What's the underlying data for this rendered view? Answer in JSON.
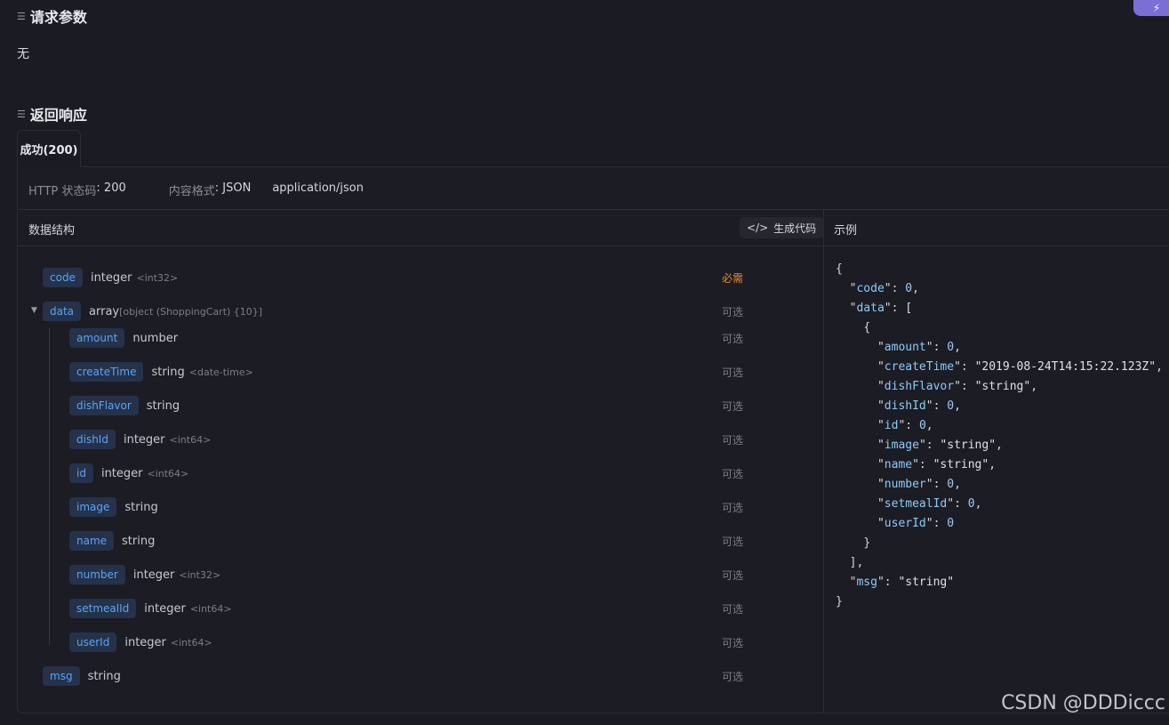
{
  "request": {
    "title": "请求参数",
    "body_text": "无"
  },
  "response": {
    "title": "返回响应",
    "tab_label": "成功(200)",
    "status_label": "HTTP 状态码",
    "status_value": ": 200",
    "format_label": "内容格式",
    "format_value": ": JSON",
    "mime": "application/json",
    "struct_header": "数据结构",
    "gen_code_label": "生成代码",
    "example_header": "示例"
  },
  "fields": [
    {
      "name": "code",
      "type": "integer",
      "format": "<int32>",
      "req": "必需"
    },
    {
      "name": "data",
      "type": "array",
      "format": "[object (ShoppingCart) {10}]",
      "req": "可选"
    },
    {
      "name": "amount",
      "type": "number",
      "format": "",
      "req": "可选"
    },
    {
      "name": "createTime",
      "type": "string",
      "format": "<date-time>",
      "req": "可选"
    },
    {
      "name": "dishFlavor",
      "type": "string",
      "format": "",
      "req": "可选"
    },
    {
      "name": "dishId",
      "type": "integer",
      "format": "<int64>",
      "req": "可选"
    },
    {
      "name": "id",
      "type": "integer",
      "format": "<int64>",
      "req": "可选"
    },
    {
      "name": "image",
      "type": "string",
      "format": "",
      "req": "可选"
    },
    {
      "name": "name",
      "type": "string",
      "format": "",
      "req": "可选"
    },
    {
      "name": "number",
      "type": "integer",
      "format": "<int32>",
      "req": "可选"
    },
    {
      "name": "setmealId",
      "type": "integer",
      "format": "<int64>",
      "req": "可选"
    },
    {
      "name": "userId",
      "type": "integer",
      "format": "<int64>",
      "req": "可选"
    },
    {
      "name": "msg",
      "type": "string",
      "format": "",
      "req": "可选"
    }
  ],
  "example_json": [
    {
      "t": "{"
    },
    {
      "k": "code",
      "v": "0",
      "n": true,
      "c": ","
    },
    {
      "k": "data",
      "v": "[",
      "c": ""
    },
    {
      "t": "{"
    },
    {
      "k": "amount",
      "v": "0",
      "n": true,
      "c": ","
    },
    {
      "k": "createTime",
      "v": "\"2019-08-24T14:15:22.123Z\"",
      "c": ","
    },
    {
      "k": "dishFlavor",
      "v": "\"string\"",
      "c": ","
    },
    {
      "k": "dishId",
      "v": "0",
      "n": true,
      "c": ","
    },
    {
      "k": "id",
      "v": "0",
      "n": true,
      "c": ","
    },
    {
      "k": "image",
      "v": "\"string\"",
      "c": ","
    },
    {
      "k": "name",
      "v": "\"string\"",
      "c": ","
    },
    {
      "k": "number",
      "v": "0",
      "n": true,
      "c": ","
    },
    {
      "k": "setmealId",
      "v": "0",
      "n": true,
      "c": ","
    },
    {
      "k": "userId",
      "v": "0",
      "n": true,
      "c": ""
    },
    {
      "t": "}"
    },
    {
      "t": "],"
    },
    {
      "k": "msg",
      "v": "\"string\"",
      "c": ""
    },
    {
      "t": "}"
    }
  ],
  "watermark": "CSDN @DDDiccc",
  "icons": {
    "section": "section-list-icon",
    "code": "code-brackets-icon",
    "caret": "caret-down-icon",
    "top_button": "lightning-icon"
  }
}
